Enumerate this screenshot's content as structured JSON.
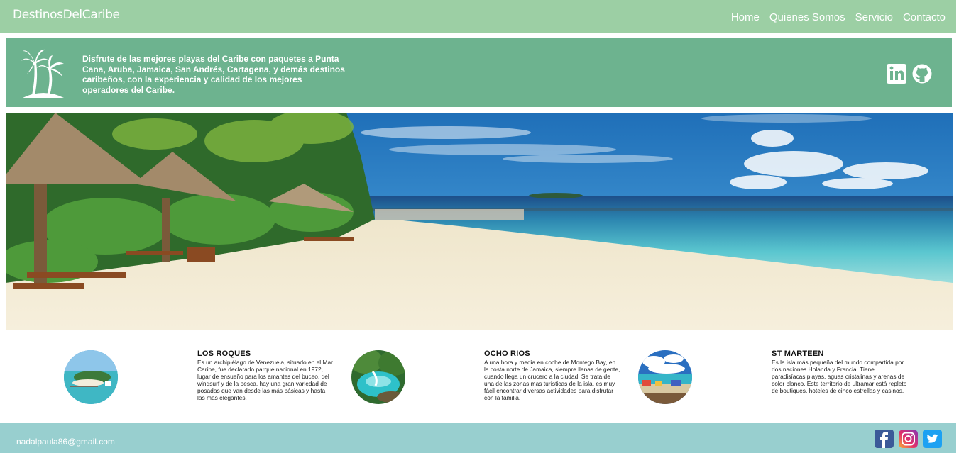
{
  "header": {
    "logo_part1": "Destinos",
    "logo_part2": "Del",
    "logo_part3": "Caribe",
    "nav": [
      "Home",
      "Quienes Somos",
      "Servicio",
      "Contacto"
    ]
  },
  "banner": {
    "text": "Disfrute de las mejores playas del Caribe con paquetes a Punta Cana, Aruba, Jamaica, San Andrés, Cartagena, y demás destinos caribeños, con la experiencia y calidad de los mejores operadores del Caribe.",
    "icons": [
      "palm-tree-icon",
      "linkedin-icon",
      "github-icon"
    ]
  },
  "destinations": [
    {
      "title": "LOS ROQUES",
      "description": "Es un archipiélago de Venezuela, situado en el Mar Caribe, fue declarado parque nacional en 1972, lugar de ensueño para los amantes del buceo, del windsurf y de la pesca, hay una gran variedad de posadas que van desde las más básicas y hasta las más elegantes."
    },
    {
      "title": "OCHO RIOS",
      "description": "A una hora y media en coche de Montego Bay, en la costa norte de Jamaica, siempre llenas de gente, cuando llega un crucero a la ciudad. Se trata de una de las zonas mas turísticas de la isla, es muy fácil encontrar diversas actividades para disfrutar con la familia."
    },
    {
      "title": "ST MARTEEN",
      "description": "Es la isla más pequeña del mundo compartida por dos naciones Holanda y Francia. Tiene paradisíacas playas, aguas cristalinas y arenas de color blanco. Este territorio de ultramar está repleto de boutiques, hoteles de cinco estrellas y casinos."
    }
  ],
  "footer": {
    "email": "nadalpaula86@gmail.com",
    "social": [
      "facebook-icon",
      "instagram-icon",
      "twitter-icon"
    ]
  },
  "colors": {
    "header_bg": "#9ccfa4",
    "banner_bg": "#6db38f",
    "footer_bg": "#98cfcf"
  }
}
